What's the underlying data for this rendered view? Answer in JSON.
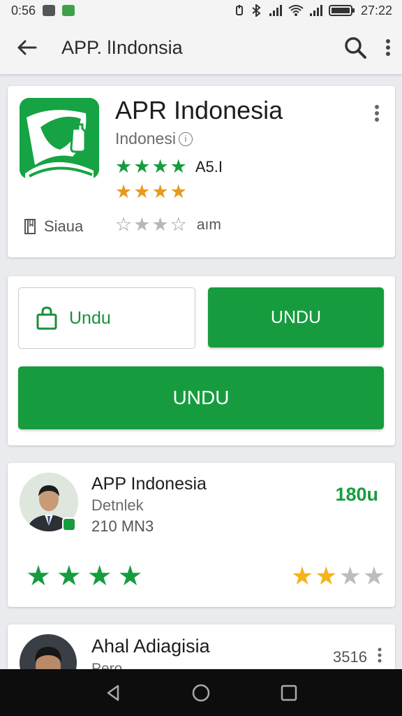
{
  "status_bar": {
    "time_left": "0:56",
    "time_right": "27:22"
  },
  "app_bar": {
    "title": "APP. lIndonsia"
  },
  "app": {
    "name": "APR Indonesia",
    "subtitle": "Indonesi",
    "info_glyph": "i",
    "rating_label": "A5.I",
    "category": "Siaua",
    "rating_label2": "aım",
    "icon_color": "#15a344"
  },
  "actions": {
    "outline_button": "Undu",
    "green_button": "UNDU",
    "wide_button": "UNDU"
  },
  "reviews": [
    {
      "name": "APP Indonesia",
      "subtitle": "Detnlek",
      "date": "210 MN3",
      "score": "180u"
    },
    {
      "name": "Ahal Adiagisia",
      "subtitle": "Pero",
      "score": "3516"
    }
  ],
  "colors": {
    "accent_green": "#169c3e",
    "star_orange": "#e69a1e",
    "star_yellow": "#f4b41a"
  }
}
